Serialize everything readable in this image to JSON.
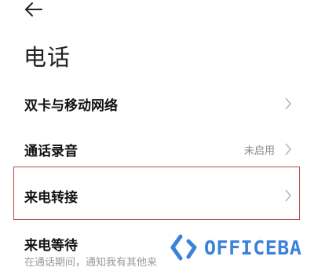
{
  "header": {
    "title": "电话"
  },
  "items": [
    {
      "label": "双卡与移动网络",
      "status": ""
    },
    {
      "label": "通话录音",
      "status": "未启用"
    },
    {
      "label": "来电转接",
      "status": ""
    },
    {
      "label": "来电等待",
      "sub": "在通话期间，通知我有其他来"
    }
  ],
  "watermark": {
    "text": "OFFICEBA"
  },
  "colors": {
    "highlight": "#b84a4a",
    "watermark": "#3b82d8"
  },
  "icons": {
    "back": "back-arrow-icon",
    "chevron": "chevron-right-icon"
  }
}
